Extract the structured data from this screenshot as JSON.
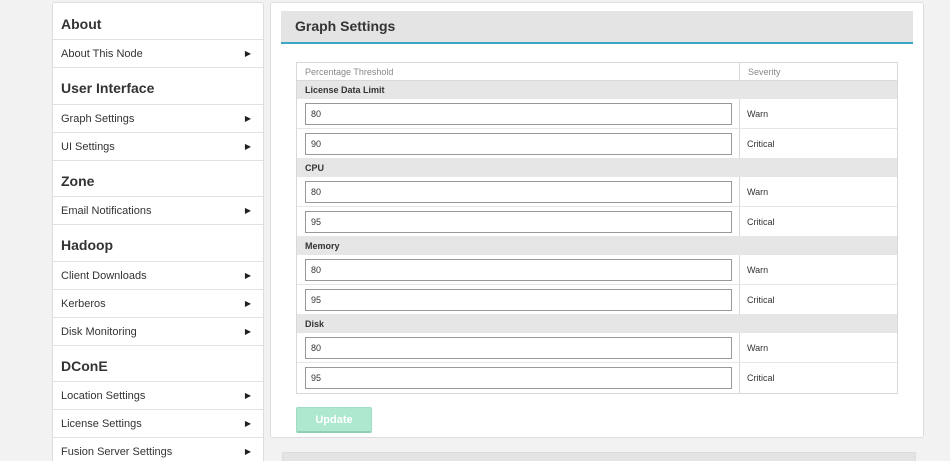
{
  "sidebar": {
    "sections": [
      {
        "title": "About",
        "items": [
          {
            "label": "About This Node"
          }
        ]
      },
      {
        "title": "User Interface",
        "items": [
          {
            "label": "Graph Settings"
          },
          {
            "label": "UI Settings"
          }
        ]
      },
      {
        "title": "Zone",
        "items": [
          {
            "label": "Email Notifications"
          }
        ]
      },
      {
        "title": "Hadoop",
        "items": [
          {
            "label": "Client Downloads"
          },
          {
            "label": "Kerberos"
          },
          {
            "label": "Disk Monitoring"
          }
        ]
      },
      {
        "title": "DConE",
        "items": [
          {
            "label": "Location Settings"
          },
          {
            "label": "License Settings"
          },
          {
            "label": "Fusion Server Settings"
          }
        ]
      }
    ],
    "arrow_glyph": "▶"
  },
  "panel": {
    "title": "Graph Settings",
    "table": {
      "headers": {
        "threshold": "Percentage Threshold",
        "severity": "Severity"
      },
      "groups": [
        {
          "name": "License Data Limit",
          "rows": [
            {
              "value": "80",
              "severity": "Warn"
            },
            {
              "value": "90",
              "severity": "Critical"
            }
          ]
        },
        {
          "name": "CPU",
          "rows": [
            {
              "value": "80",
              "severity": "Warn"
            },
            {
              "value": "95",
              "severity": "Critical"
            }
          ]
        },
        {
          "name": "Memory",
          "rows": [
            {
              "value": "80",
              "severity": "Warn"
            },
            {
              "value": "95",
              "severity": "Critical"
            }
          ]
        },
        {
          "name": "Disk",
          "rows": [
            {
              "value": "80",
              "severity": "Warn"
            },
            {
              "value": "95",
              "severity": "Critical"
            }
          ]
        }
      ]
    },
    "update_label": "Update"
  },
  "colors": {
    "accent": "#3aa6c4",
    "update_button": "#aee8cf"
  }
}
